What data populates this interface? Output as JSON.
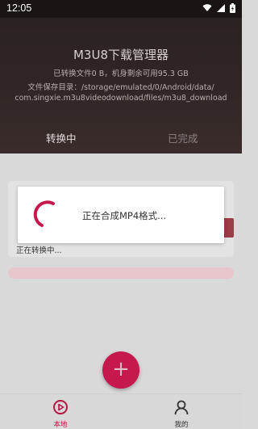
{
  "status_bar": {
    "time": "12:05",
    "icons": [
      "wifi-icon",
      "signal-icon",
      "battery-icon"
    ]
  },
  "header": {
    "title": "M3U8下载管理器",
    "stats": "已转换文件0 B，机身剩余可用95.3 GB",
    "path_line1": "文件保存目录：/storage/emulated/0/Android/data/",
    "path_line2": "com.singxie.m3u8videodownload/files/m3u8_download"
  },
  "tabs": [
    {
      "label": "转换中",
      "active": true
    },
    {
      "label": "已完成",
      "active": false
    }
  ],
  "task": {
    "status_text": "正在转换中..."
  },
  "dialog": {
    "message": "正在合成MP4格式..."
  },
  "fab": {
    "icon": "plus-icon"
  },
  "bottom_nav": [
    {
      "label": "本地",
      "icon": "play-circle-icon",
      "active": true
    },
    {
      "label": "我的",
      "icon": "person-icon",
      "active": false
    }
  ],
  "colors": {
    "accent": "#c5184c",
    "header_bg": "#2b2222",
    "overlay_bg": "#d9d9d9"
  }
}
